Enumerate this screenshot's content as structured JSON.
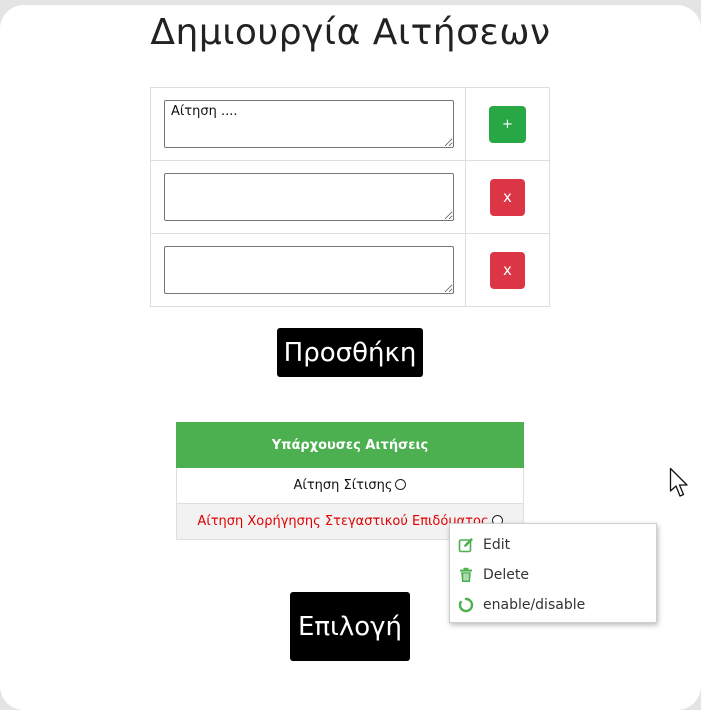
{
  "page": {
    "title": "Δημιουργία Αιτήσεων"
  },
  "requests_form": {
    "rows": [
      {
        "value": "Αίτηση ....",
        "button_label": "+",
        "button_kind": "add"
      },
      {
        "value": "",
        "button_label": "x",
        "button_kind": "delete"
      },
      {
        "value": "",
        "button_label": "x",
        "button_kind": "delete"
      }
    ],
    "submit_label": "Προσθήκη"
  },
  "existing_requests": {
    "header": "Υπάρχουσες Αιτήσεις",
    "items": [
      {
        "label": "Αίτηση Σίτισης",
        "status_color": "#111111"
      },
      {
        "label": "Αίτηση Χορήγησης Στεγαστικού Επιδόματος",
        "status_color": "#e00000"
      }
    ]
  },
  "context_menu": {
    "items": [
      {
        "label": "Edit",
        "icon": "edit-icon"
      },
      {
        "label": "Delete",
        "icon": "trash-icon"
      },
      {
        "label": "enable/disable",
        "icon": "toggle-circle-icon"
      }
    ],
    "icon_color": "#4caf50"
  },
  "select_button_label": "Επιλογή",
  "colors": {
    "add": "#28a745",
    "delete": "#dc3545",
    "header": "#4caf50",
    "disabled_text": "#e00000"
  }
}
